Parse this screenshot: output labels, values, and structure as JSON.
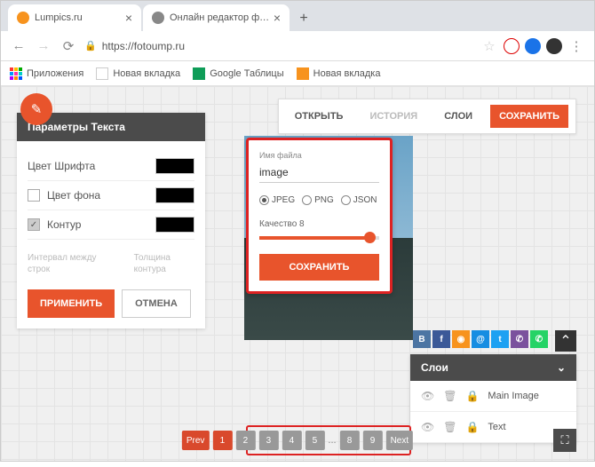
{
  "browser": {
    "tabs": [
      {
        "title": "Lumpics.ru",
        "favicon": "#f7931e"
      },
      {
        "title": "Онлайн редактор фото изобра",
        "favicon": "#888"
      }
    ],
    "url": "https://fotoump.ru",
    "bookmarks": {
      "apps": "Приложения",
      "b1": "Новая вкладка",
      "b2": "Google Таблицы",
      "b3": "Новая вкладка"
    }
  },
  "top_actions": {
    "open": "ОТКРЫТЬ",
    "history": "ИСТОРИЯ",
    "layers": "СЛОИ",
    "save": "СОХРАНИТЬ"
  },
  "text_panel": {
    "title": "Параметры Текста",
    "font_color": "Цвет Шрифта",
    "bg_color": "Цвет фона",
    "outline": "Контур",
    "line_spacing": "Интервал между строк",
    "outline_width": "Толщина контура",
    "apply": "ПРИМЕНИТЬ",
    "cancel": "ОТМЕНА"
  },
  "save_dialog": {
    "filename_label": "Имя файла",
    "filename": "image",
    "formats": {
      "jpeg": "JPEG",
      "png": "PNG",
      "json": "JSON"
    },
    "selected_format": "jpeg",
    "quality_label": "Качество 8",
    "save": "СОХРАНИТЬ"
  },
  "layers_panel": {
    "title": "Слои",
    "items": [
      {
        "name": "Main Image"
      },
      {
        "name": "Text"
      }
    ]
  },
  "share": [
    "VK",
    "F",
    "OK",
    "M",
    "T",
    "S",
    "W"
  ],
  "share_colors": [
    "#4c75a3",
    "#3b5998",
    "#f7931e",
    "#168de2",
    "#1da1f2",
    "#7bb32e",
    "#25d366"
  ],
  "pager": {
    "prev": "Prev",
    "pages": [
      "1",
      "2",
      "3",
      "4",
      "5",
      "...",
      "8",
      "9"
    ],
    "next": "Next",
    "active": 0
  }
}
